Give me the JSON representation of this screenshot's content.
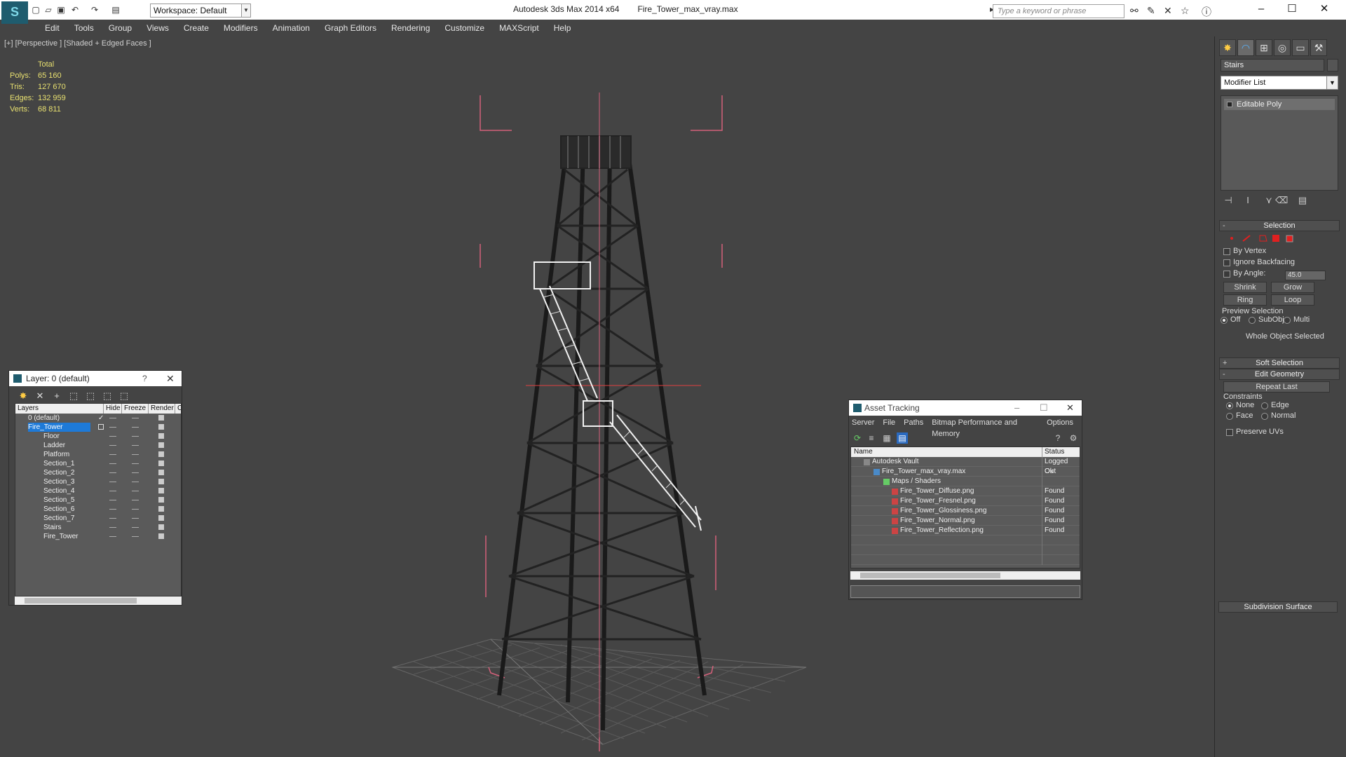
{
  "titlebar": {
    "workspace": "Workspace: Default",
    "app_name": "Autodesk 3ds Max  2014 x64",
    "file_name": "Fire_Tower_max_vray.max",
    "search_placeholder": "Type a keyword or phrase"
  },
  "menu": [
    "Edit",
    "Tools",
    "Group",
    "Views",
    "Create",
    "Modifiers",
    "Animation",
    "Graph Editors",
    "Rendering",
    "Customize",
    "MAXScript",
    "Help"
  ],
  "viewport": {
    "label": "[+] [Perspective ] [Shaded + Edged Faces ]",
    "stats": {
      "header": "Total",
      "polys_label": "Polys:",
      "polys": "65 160",
      "tris_label": "Tris:",
      "tris": "127 670",
      "edges_label": "Edges:",
      "edges": "132 959",
      "verts_label": "Verts:",
      "verts": "68 811"
    }
  },
  "command_panel": {
    "object_name": "Stairs",
    "modifier_list": "Modifier List",
    "stack_item": "Editable Poly",
    "selection": {
      "title": "Selection",
      "by_vertex": "By Vertex",
      "ignore_backfacing": "Ignore Backfacing",
      "by_angle": "By Angle:",
      "angle_value": "45.0",
      "shrink": "Shrink",
      "grow": "Grow",
      "ring": "Ring",
      "loop": "Loop",
      "preview_selection": "Preview Selection",
      "off": "Off",
      "subobj": "SubObj",
      "multi": "Multi",
      "status": "Whole Object Selected"
    },
    "soft_selection": "Soft Selection",
    "edit_geometry": {
      "title": "Edit Geometry",
      "repeat_last": "Repeat Last",
      "constraints": "Constraints",
      "none": "None",
      "edge": "Edge",
      "face": "Face",
      "normal": "Normal",
      "preserve_uvs": "Preserve UVs"
    },
    "subdivision_surface": "Subdivision Surface"
  },
  "layer_window": {
    "title": "Layer: 0 (default)",
    "help": "?",
    "columns": [
      "Layers",
      "Hide",
      "Freeze",
      "Render",
      "C"
    ],
    "rows": [
      {
        "name": "0 (default)"
      },
      {
        "name": "Fire_Tower"
      },
      {
        "name": "Floor"
      },
      {
        "name": "Ladder"
      },
      {
        "name": "Platform"
      },
      {
        "name": "Section_1"
      },
      {
        "name": "Section_2"
      },
      {
        "name": "Section_3"
      },
      {
        "name": "Section_4"
      },
      {
        "name": "Section_5"
      },
      {
        "name": "Section_6"
      },
      {
        "name": "Section_7"
      },
      {
        "name": "Stairs"
      },
      {
        "name": "Fire_Tower"
      }
    ]
  },
  "asset_window": {
    "title": "Asset Tracking",
    "menu": [
      "Server",
      "File",
      "Paths",
      "Bitmap Performance and Memory",
      "Options"
    ],
    "col_name": "Name",
    "col_status": "Status",
    "rows": [
      {
        "name": "Autodesk Vault",
        "status": "Logged Out"
      },
      {
        "name": "Fire_Tower_max_vray.max",
        "status": "Ok"
      },
      {
        "name": "Maps / Shaders",
        "status": ""
      },
      {
        "name": "Fire_Tower_Diffuse.png",
        "status": "Found"
      },
      {
        "name": "Fire_Tower_Fresnel.png",
        "status": "Found"
      },
      {
        "name": "Fire_Tower_Glossiness.png",
        "status": "Found"
      },
      {
        "name": "Fire_Tower_Normal.png",
        "status": "Found"
      },
      {
        "name": "Fire_Tower_Reflection.png",
        "status": "Found"
      }
    ]
  },
  "colors": {
    "accent": "#1e7ad8",
    "stats_text": "#e8e070",
    "selection_red": "#e02020"
  }
}
